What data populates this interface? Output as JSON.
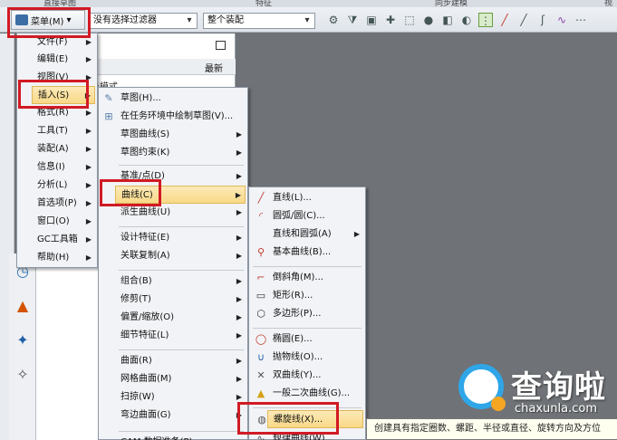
{
  "top_strip": [
    "直接草图",
    "特征",
    "同步建模",
    "视"
  ],
  "toolbar": {
    "menu_label": "菜单(M)",
    "menu_arrow": "▾",
    "filter_value": "没有选择过滤器",
    "assembly_value": "整个装配"
  },
  "navigator": {
    "recent_col": "最新",
    "partial_text": "录模式"
  },
  "main_menu": [
    {
      "label": "文件(F)"
    },
    {
      "label": "编辑(E)"
    },
    {
      "label": "视图(V)"
    },
    {
      "label": "插入(S)"
    },
    {
      "label": "格式(R)"
    },
    {
      "label": "工具(T)"
    },
    {
      "label": "装配(A)"
    },
    {
      "label": "信息(I)"
    },
    {
      "label": "分析(L)"
    },
    {
      "label": "首选项(P)"
    },
    {
      "label": "窗口(O)"
    },
    {
      "label": "GC工具箱"
    },
    {
      "label": "帮助(H)"
    }
  ],
  "insert_menu": [
    {
      "label": "草图(H)..."
    },
    {
      "label": "在任务环境中绘制草图(V)..."
    },
    {
      "label": "草图曲线(S)"
    },
    {
      "label": "草图约束(K)"
    },
    {
      "label": "基准/点(D)"
    },
    {
      "label": "曲线(C)"
    },
    {
      "label": "派生曲线(U)"
    },
    {
      "label": "设计特征(E)"
    },
    {
      "label": "关联复制(A)"
    },
    {
      "label": "组合(B)"
    },
    {
      "label": "修剪(T)"
    },
    {
      "label": "偏置/缩放(O)"
    },
    {
      "label": "细节特征(L)"
    },
    {
      "label": "曲面(R)"
    },
    {
      "label": "网格曲面(M)"
    },
    {
      "label": "扫掠(W)"
    },
    {
      "label": "弯边曲面(G)"
    },
    {
      "label": "CAM 数据准备(P)"
    }
  ],
  "curve_menu": [
    {
      "label": "直线(L)..."
    },
    {
      "label": "圆弧/圆(C)..."
    },
    {
      "label": "直线和圆弧(A)"
    },
    {
      "label": "基本曲线(B)..."
    },
    {
      "label": "倒斜角(M)..."
    },
    {
      "label": "矩形(R)..."
    },
    {
      "label": "多边形(P)..."
    },
    {
      "label": "椭圆(E)..."
    },
    {
      "label": "抛物线(O)..."
    },
    {
      "label": "双曲线(Y)..."
    },
    {
      "label": "一般二次曲线(G)..."
    },
    {
      "label": "螺旋线(X)..."
    },
    {
      "label": "规律曲线(W)..."
    }
  ],
  "tooltip": "创建具有指定圈数、螺距、半径或直径、旋转方向及方位",
  "watermark": {
    "text": "查询啦",
    "url": "chaxunla.com"
  }
}
